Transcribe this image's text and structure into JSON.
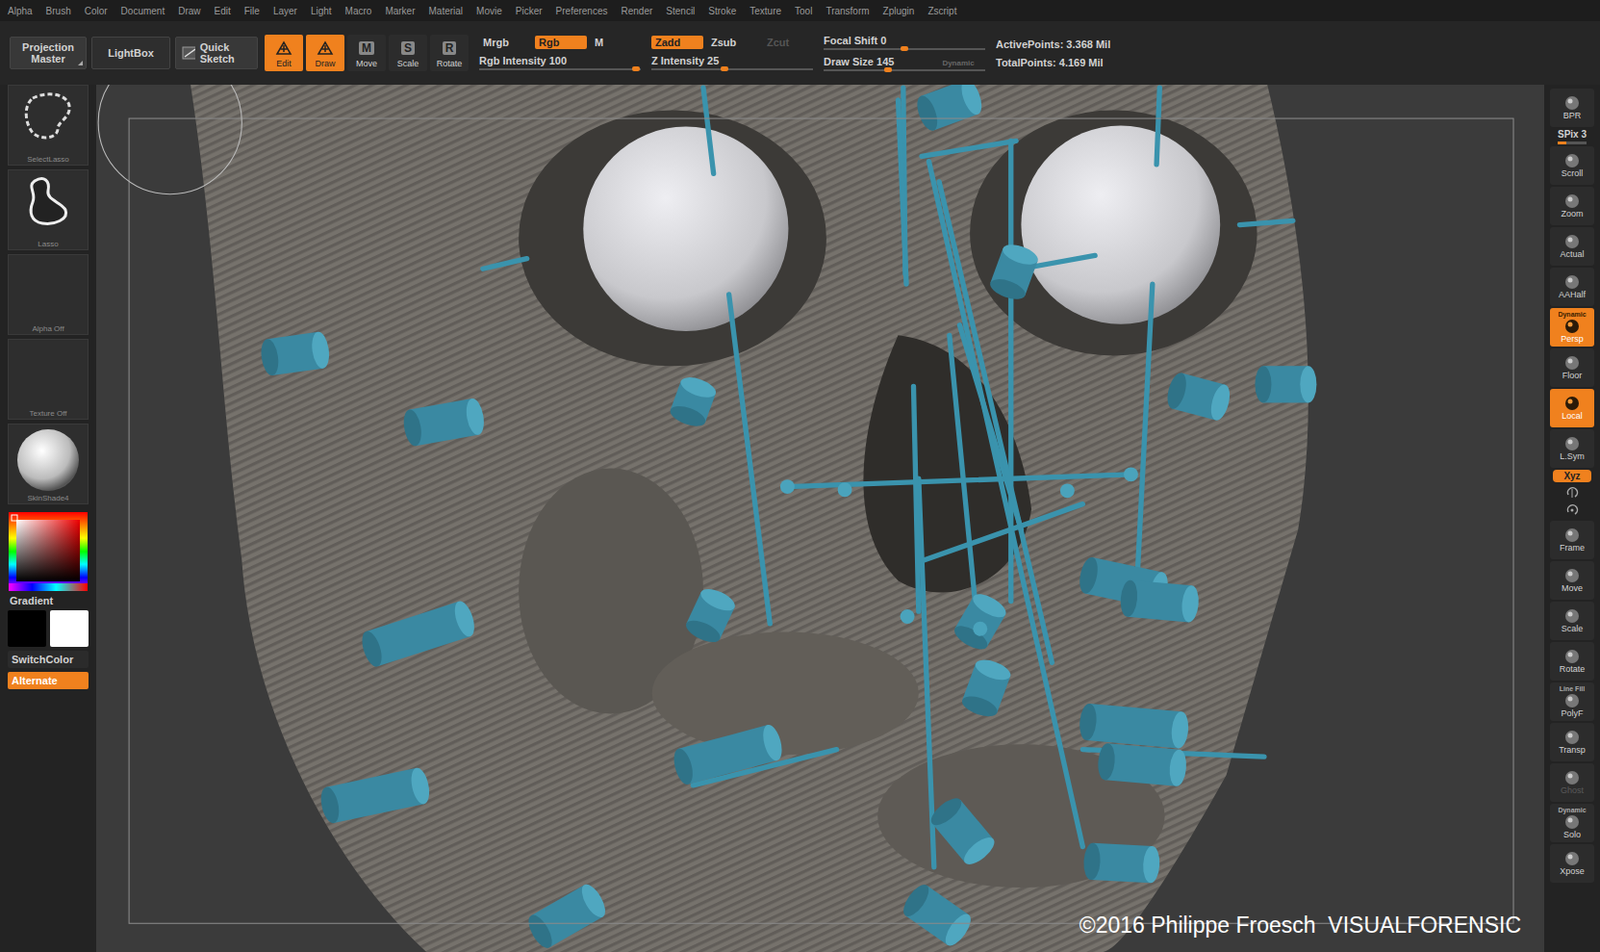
{
  "menu": [
    "Alpha",
    "Brush",
    "Color",
    "Document",
    "Draw",
    "Edit",
    "File",
    "Layer",
    "Light",
    "Macro",
    "Marker",
    "Material",
    "Movie",
    "Picker",
    "Preferences",
    "Render",
    "Stencil",
    "Stroke",
    "Texture",
    "Tool",
    "Transform",
    "Zplugin",
    "Zscript"
  ],
  "toolbar": {
    "projection_master": "Projection Master",
    "lightbox": "LightBox",
    "quick_sketch": "Quick Sketch",
    "tools": [
      {
        "label": "Edit",
        "key": "",
        "selected": true
      },
      {
        "label": "Draw",
        "key": "",
        "selected": true
      },
      {
        "label": "Move",
        "key": "M",
        "selected": false
      },
      {
        "label": "Scale",
        "key": "S",
        "selected": false
      },
      {
        "label": "Rotate",
        "key": "R",
        "selected": false
      }
    ],
    "color_modes": [
      {
        "label": "Mrgb",
        "selected": false
      },
      {
        "label": "Rgb",
        "selected": true
      },
      {
        "label": "M",
        "selected": false
      }
    ],
    "rgb_intensity": {
      "label": "Rgb Intensity",
      "value": "100",
      "level": 0.97
    },
    "z_modes": [
      {
        "label": "Zadd",
        "selected": true,
        "disabled": false
      },
      {
        "label": "Zsub",
        "selected": false,
        "disabled": false
      },
      {
        "label": "Zcut",
        "selected": false,
        "disabled": true
      }
    ],
    "z_intensity": {
      "label": "Z Intensity",
      "value": "25",
      "level": 0.45
    },
    "focal_shift": {
      "label": "Focal Shift",
      "value": "0",
      "level": 0.5
    },
    "draw_size": {
      "label": "Draw Size",
      "value": "145",
      "level": 0.4,
      "note": "Dynamic"
    },
    "stats": [
      {
        "label": "ActivePoints:",
        "value": "3.368",
        "unit": "Mil"
      },
      {
        "label": "TotalPoints:",
        "value": "4.169",
        "unit": "Mil"
      }
    ]
  },
  "left_shelf": {
    "tiles": [
      {
        "label": "SelectLasso",
        "kind": "select-lasso"
      },
      {
        "label": "Lasso",
        "kind": "lasso"
      },
      {
        "label": "Alpha Off",
        "kind": "empty"
      },
      {
        "label": "Texture Off",
        "kind": "empty"
      },
      {
        "label": "SkinShade4",
        "kind": "material"
      }
    ],
    "gradient": "Gradient",
    "switch_color": "SwitchColor",
    "alternate": {
      "label": "Alternate",
      "on": true
    }
  },
  "right_shelf": [
    {
      "label": "BPR",
      "kind": "button",
      "selected": false,
      "disabled": false,
      "note": ""
    },
    {
      "label": "SPix 3",
      "kind": "slider",
      "selected": false,
      "disabled": false,
      "note": "",
      "level": 0.3
    },
    {
      "label": "Scroll",
      "kind": "button",
      "selected": false,
      "disabled": false,
      "note": ""
    },
    {
      "label": "Zoom",
      "kind": "button",
      "selected": false,
      "disabled": false,
      "note": ""
    },
    {
      "label": "Actual",
      "kind": "button",
      "selected": false,
      "disabled": false,
      "note": ""
    },
    {
      "label": "AAHalf",
      "kind": "button",
      "selected": false,
      "disabled": false,
      "note": ""
    },
    {
      "label": "Persp",
      "kind": "button",
      "selected": true,
      "disabled": false,
      "note": "Dynamic"
    },
    {
      "label": "Floor",
      "kind": "button",
      "selected": false,
      "disabled": false,
      "note": ""
    },
    {
      "label": "Local",
      "kind": "button",
      "selected": true,
      "disabled": false,
      "note": ""
    },
    {
      "label": "L.Sym",
      "kind": "button",
      "selected": false,
      "disabled": false,
      "note": ""
    },
    {
      "label": "Xyz",
      "kind": "pill",
      "selected": true,
      "disabled": false,
      "note": ""
    },
    {
      "label": "Frame",
      "kind": "button",
      "selected": false,
      "disabled": false,
      "note": ""
    },
    {
      "label": "Move",
      "kind": "button",
      "selected": false,
      "disabled": false,
      "note": ""
    },
    {
      "label": "Scale",
      "kind": "button",
      "selected": false,
      "disabled": false,
      "note": ""
    },
    {
      "label": "Rotate",
      "kind": "button",
      "selected": false,
      "disabled": false,
      "note": ""
    },
    {
      "label": "PolyF",
      "kind": "button",
      "selected": false,
      "disabled": false,
      "note": "Line Fill"
    },
    {
      "label": "Transp",
      "kind": "button",
      "selected": false,
      "disabled": false,
      "note": ""
    },
    {
      "label": "Ghost",
      "kind": "button",
      "selected": false,
      "disabled": true,
      "note": ""
    },
    {
      "label": "Solo",
      "kind": "button",
      "selected": false,
      "disabled": false,
      "note": "Dynamic"
    },
    {
      "label": "Xpose",
      "kind": "button",
      "selected": false,
      "disabled": false,
      "note": ""
    }
  ],
  "canvas": {
    "watermark": "©2016 Philippe Froesch  VISUALFORENSIC"
  }
}
